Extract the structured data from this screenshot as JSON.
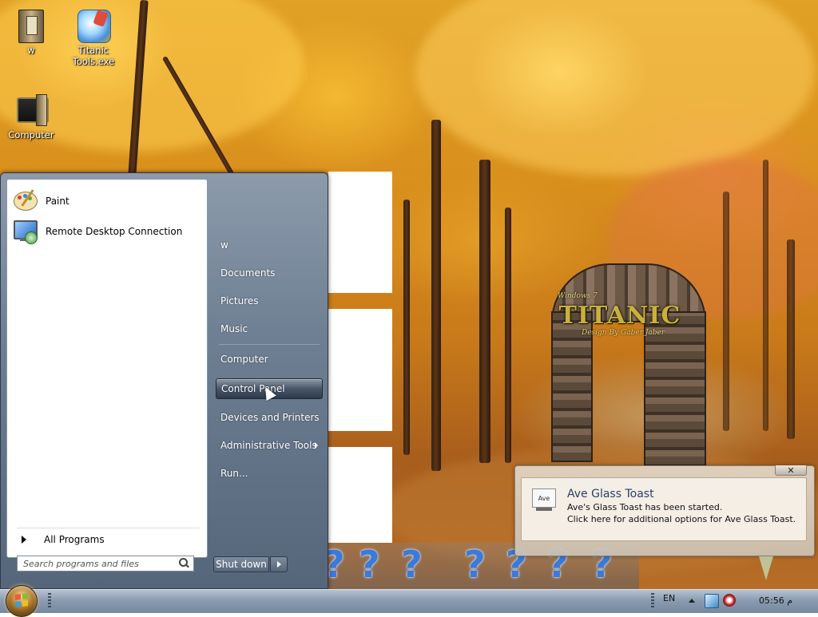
{
  "desktop": {
    "icons": [
      {
        "label": "w"
      },
      {
        "label": "Titanic Tools.exe"
      },
      {
        "label": "Computer"
      }
    ]
  },
  "start_menu": {
    "pinned_programs": [
      {
        "label": "Paint",
        "icon": "paint-palette-icon"
      },
      {
        "label": "Remote Desktop Connection",
        "icon": "remote-desktop-icon"
      }
    ],
    "all_programs_label": "All Programs",
    "search": {
      "placeholder": "Search programs and files",
      "value": ""
    },
    "right_items": [
      {
        "label": "w"
      },
      {
        "label": "Documents"
      },
      {
        "label": "Pictures"
      },
      {
        "label": "Music"
      },
      {
        "label": "Computer"
      },
      {
        "label": "Control Panel",
        "highlighted": true
      },
      {
        "label": "Devices and Printers"
      },
      {
        "label": "Administrative Tools",
        "has_submenu": true
      },
      {
        "label": "Run..."
      }
    ],
    "shutdown_label": "Shut down"
  },
  "toast": {
    "close_glyph": "✕",
    "icon_text": "Ave",
    "title": "Ave Glass Toast",
    "line1": "Ave's Glass Toast has been started.",
    "line2": "Click here for additional options for Ave Glass Toast."
  },
  "wallpaper": {
    "logo_text": "TITANIC",
    "logo_top": "Windows 7",
    "logo_bottom": "Design By Gaber Jaber"
  },
  "taskbar": {
    "question_icons": [
      "?",
      "?",
      "?",
      "?",
      "?",
      "?",
      "?"
    ],
    "language": "EN",
    "clock": "05:56 م"
  },
  "colors": {
    "start_menu_glass": "#6e7f93",
    "highlight": "#49566a",
    "toast_title": "#2a3f6a",
    "taskbar": "#8b9bb0"
  }
}
